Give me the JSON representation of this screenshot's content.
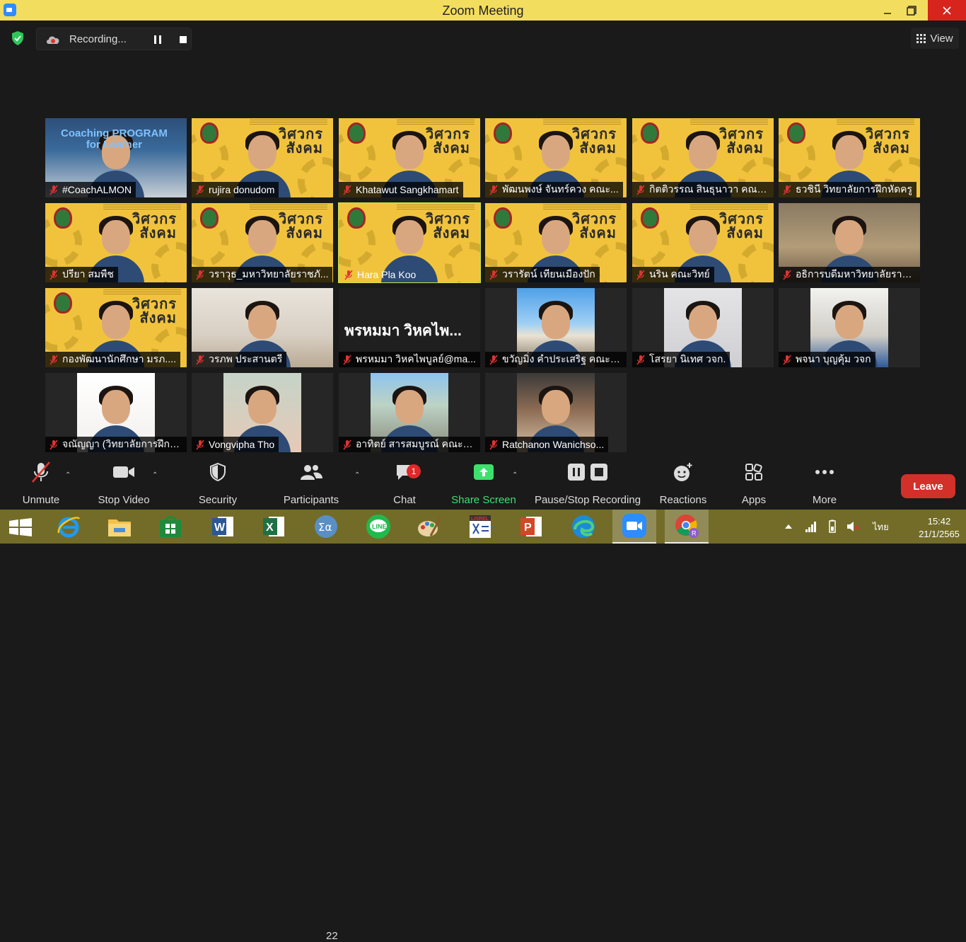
{
  "window": {
    "title": "Zoom Meeting",
    "minimize": "—",
    "maximize": "▭",
    "close": "✕"
  },
  "recording": {
    "label": "Recording..."
  },
  "view": {
    "label": "View"
  },
  "participants_tiles": [
    {
      "name": "#CoachALMON",
      "bg": "photo-coaching",
      "banner": "Coaching PROGRAM\nfor Learner"
    },
    {
      "name": "rujira donudom",
      "bg": "yellow"
    },
    {
      "name": "Khatawut Sangkhamart",
      "bg": "yellow"
    },
    {
      "name": "พัฒนพงษ์ จันทร์ควง คณะ...",
      "bg": "yellow"
    },
    {
      "name": "กิตติวรรณ สินธุนาวา คณะ...",
      "bg": "yellow"
    },
    {
      "name": "ธวชินี  วิทยาลัยการฝึกหัดครู",
      "bg": "yellow"
    },
    {
      "name": "ปรียา สมพืช",
      "bg": "yellow"
    },
    {
      "name": "วราวุธ_มหาวิทยาลัยราชภั...",
      "bg": "yellow"
    },
    {
      "name": "Hara Pla Koo",
      "bg": "yellow",
      "active": true
    },
    {
      "name": "วรารัตน์ เทียนเมืองปัก",
      "bg": "yellow"
    },
    {
      "name": "นริน คณะวิทย์",
      "bg": "yellow"
    },
    {
      "name": "อธิการบดีมหาวิทยาลัยราช...",
      "bg": "photo-office"
    },
    {
      "name": "กองพัฒนานักศึกษา มรภ....",
      "bg": "yellow"
    },
    {
      "name": "วรภพ ประสานตรี",
      "bg": "photo-room"
    },
    {
      "name": "พรหมมา วิหคไพบูลย์@ma...",
      "bg": "dark",
      "big_name": "พรหมมา วิหคไพ..."
    },
    {
      "name": "ขวัญมิ่ง คำประเสริฐ คณะวิ...",
      "bg": "photo-opera"
    },
    {
      "name": "โสรยา นิเทศ วจก.",
      "bg": "photo-woman"
    },
    {
      "name": "พจนา บุญคุ้ม วจก",
      "bg": "photo-office2"
    },
    {
      "name": "จณัญญา (วิทยาลัยการฝึกหั...",
      "bg": "photo-portrait"
    },
    {
      "name": "Vongvipha Tho",
      "bg": "photo-portrait2"
    },
    {
      "name": "อาทิตย์ สารสมบูรณ์ คณะวิ...",
      "bg": "photo-street"
    },
    {
      "name": "Ratchanon Wanichso...",
      "bg": "photo-food"
    }
  ],
  "yellow_brand": "วิศวกร\nสังคม",
  "toolbar": {
    "unmute": "Unmute",
    "stop_video": "Stop Video",
    "security": "Security",
    "participants": "Participants",
    "participants_count": "22",
    "chat": "Chat",
    "chat_badge": "1",
    "share_screen": "Share Screen",
    "pause_stop_recording": "Pause/Stop Recording",
    "reactions": "Reactions",
    "apps": "Apps",
    "more": "More",
    "leave": "Leave"
  },
  "taskbar": {
    "language": "ไทย",
    "time": "15:42",
    "date": "21/1/2565",
    "icons": [
      "windows-start-icon",
      "internet-explorer-icon",
      "file-explorer-icon",
      "store-icon",
      "word-icon",
      "excel-icon",
      "math-input-icon",
      "line-icon",
      "paint-icon",
      "lisrel-icon",
      "powerpoint-icon",
      "edge-icon",
      "zoom-icon",
      "chrome-icon"
    ]
  },
  "colors": {
    "titlebar": "#f3dd5e",
    "taskbar": "#726c28",
    "leave": "#d3302a",
    "share": "#3ee06d",
    "yellow_bg": "#f1c33d"
  }
}
